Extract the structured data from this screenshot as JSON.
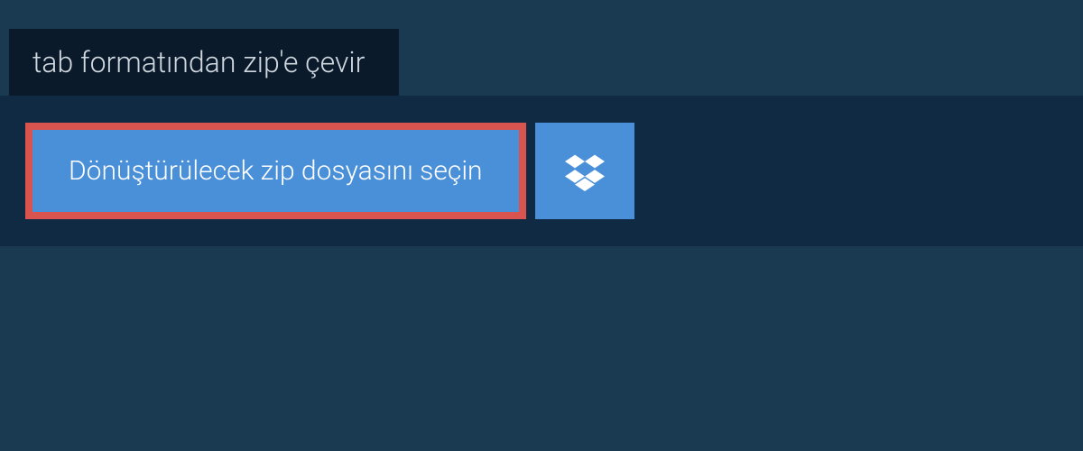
{
  "header": {
    "tab_label": "tab formatından zip'e çevir"
  },
  "main": {
    "file_select_label": "Dönüştürülecek zip dosyasını seçin"
  },
  "colors": {
    "bg_outer": "#1a3a52",
    "bg_tab": "#0a1a2a",
    "bg_panel": "#0f2a42",
    "button_bg": "#4a90d9",
    "button_border": "#d9534f",
    "text_light": "#d0d8e0",
    "text_white": "#ffffff"
  }
}
